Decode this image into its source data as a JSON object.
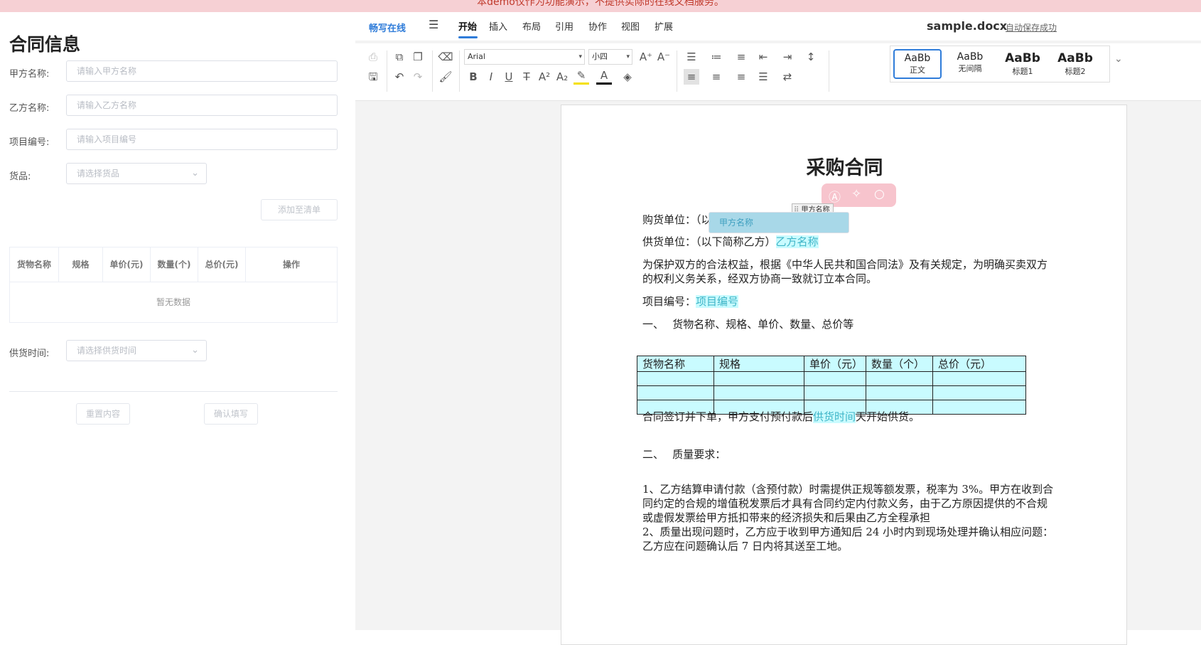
{
  "banner": {
    "text": "本demo仅作为功能演示，不提供实际的在线文档服务。"
  },
  "form": {
    "title": "合同信息",
    "party_a": {
      "label": "甲方名称:",
      "placeholder": "请输入甲方名称"
    },
    "party_b": {
      "label": "乙方名称:",
      "placeholder": "请输入乙方名称"
    },
    "project_no": {
      "label": "项目编号:",
      "placeholder": "请输入项目编号"
    },
    "goods": {
      "label": "货品:",
      "placeholder": "请选择货品"
    },
    "add_button": "添加至清单",
    "table": {
      "columns": [
        "货物名称",
        "规格",
        "单价(元)",
        "数量(个)",
        "总价(元)",
        "操作"
      ],
      "empty_text": "暂无数据"
    },
    "supply_time": {
      "label": "供货时间:",
      "placeholder": "请选择供货时间"
    },
    "reset_button": "重置内容",
    "confirm_button": "确认填写"
  },
  "editor": {
    "brand": "畅写在线",
    "menu_tabs": [
      "开始",
      "插入",
      "布局",
      "引用",
      "协作",
      "视图",
      "扩展"
    ],
    "active_tab": "开始",
    "filename": "sample.docx",
    "autosave": "自动保存成功",
    "toolbar": {
      "font_family": "Arial",
      "font_size": "小四",
      "styles": [
        {
          "sample": "AaBb",
          "name": "正文"
        },
        {
          "sample": "AaBb",
          "name": "无间隔"
        },
        {
          "sample": "AaBb",
          "name": "标题1"
        },
        {
          "sample": "AaBb",
          "name": "标题2"
        }
      ],
      "icons": [
        "print-icon",
        "save-icon",
        "copy-icon",
        "paste-icon",
        "undo-icon",
        "redo-icon",
        "eraser-icon",
        "format-painter-icon",
        "bold-icon",
        "italic-icon",
        "underline-icon",
        "strikethrough-icon",
        "superscript-icon",
        "subscript-icon",
        "highlight-icon",
        "font-color-icon",
        "shading-icon",
        "bullet-list-icon",
        "numbered-list-icon",
        "multilevel-list-icon",
        "decrease-indent-icon",
        "increase-indent-icon",
        "line-spacing-icon",
        "align-left-icon",
        "align-center-icon",
        "align-right-icon",
        "justify-icon",
        "paragraph-direction-icon",
        "increase-font-icon",
        "decrease-font-icon"
      ]
    }
  },
  "document": {
    "title": "采购合同",
    "field_tag": "甲方名称",
    "buyer_prefix": "购货单位：（以下简称甲方）",
    "buyer_field": "甲方名称",
    "supplier_prefix": "供货单位：（以下简称乙方）",
    "supplier_field": "乙方名称",
    "intro_line1": "为保护双方的合法权益，根据《中华人民共和国合同法》及有关规定，为明确买卖双方",
    "intro_line2": "的权利义务关系，经双方协商一致就订立本合同。",
    "project_prefix": "项目编号：",
    "project_field": "项目编号",
    "section1": "一、　 货物名称、规格、单价、数量、总价等",
    "table_headers": [
      "货物名称",
      "规格",
      "单价（元）",
      "数量（个）",
      "总价（元）"
    ],
    "delivery_prefix": "合同签订并下单，甲方支付预付款后",
    "delivery_field": "供货时间",
    "delivery_suffix": "天开始供货。",
    "section2": "二、　 质量要求：",
    "item1_line1": "1、乙方结算申请付款（含预付款）时需提供正规等额发票，税率为 3%。甲方在收到合",
    "item1_line2": "同约定的合规的增值税发票后才具有合同约定内付款义务，由于乙方原因提供的不合规",
    "item1_line3": "或虚假发票给甲方抵扣带来的经济损失和后果由乙方全程承担",
    "item2_line1": "2、质量出现问题时，乙方应于收到甲方通知后 24 小时内到现场处理并确认相应问题：",
    "item2_line2": "乙方应在问题确认后 7 日内将其送至工地。"
  }
}
